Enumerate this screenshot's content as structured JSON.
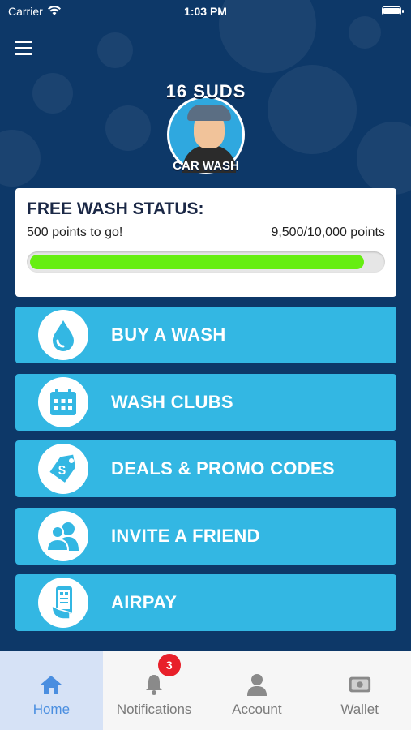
{
  "status_bar": {
    "carrier": "Carrier",
    "time": "1:03 PM"
  },
  "logo": {
    "title": "16 SUDS",
    "subtitle": "CAR WASH"
  },
  "status_card": {
    "title": "FREE WASH STATUS:",
    "remaining": "500 points to go!",
    "points": "9,500/10,000 points",
    "progress_fraction": 0.95,
    "progress_color": "#66ee11"
  },
  "actions": [
    {
      "label": "BUY A WASH",
      "icon": "water-drop-icon"
    },
    {
      "label": "WASH CLUBS",
      "icon": "calendar-icon"
    },
    {
      "label": "DEALS & PROMO CODES",
      "icon": "price-tag-icon"
    },
    {
      "label": "INVITE A FRIEND",
      "icon": "users-icon"
    },
    {
      "label": "AIRPAY",
      "icon": "phone-pay-icon"
    }
  ],
  "tabs": [
    {
      "label": "Home",
      "icon": "home-icon",
      "active": true
    },
    {
      "label": "Notifications",
      "icon": "bell-icon",
      "badge": "3"
    },
    {
      "label": "Account",
      "icon": "person-icon"
    },
    {
      "label": "Wallet",
      "icon": "wallet-icon"
    }
  ],
  "colors": {
    "background": "#0d3868",
    "button": "#33b7e3",
    "accent": "#4a8ee0",
    "badge": "#e8202a"
  }
}
